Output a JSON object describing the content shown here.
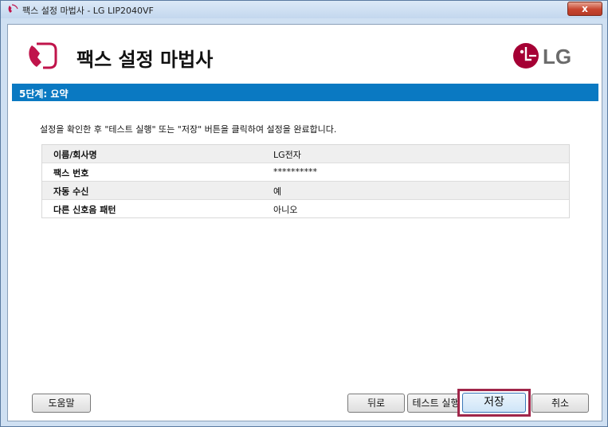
{
  "window": {
    "title": "팩스 설정 마법사 - LG LIP2040VF",
    "close_label": "x"
  },
  "header": {
    "title": "팩스 설정 마법사",
    "logo_text": "LG",
    "brand_color": "#a50034"
  },
  "step": {
    "label": "5단계: 요약",
    "color": "#0a79c2"
  },
  "instruction": "설정을 확인한 후 \"테스트 실행\" 또는 \"저장\" 버튼을 클릭하여 설정을 완료합니다.",
  "summary": {
    "rows": [
      {
        "key": "이름/회사명",
        "value": "LG전자"
      },
      {
        "key": "팩스 번호",
        "value": "**********"
      },
      {
        "key": "자동 수신",
        "value": "예"
      },
      {
        "key": "다른 신호음 패턴",
        "value": "아니오"
      }
    ]
  },
  "buttons": {
    "help": "도움말",
    "back": "뒤로",
    "test": "테스트 실행",
    "save": "저장",
    "cancel": "취소"
  },
  "icons": {
    "title": "fax-phone-icon",
    "header": "fax-phone-icon",
    "logo": "lg-logo-icon",
    "close": "close-icon"
  }
}
